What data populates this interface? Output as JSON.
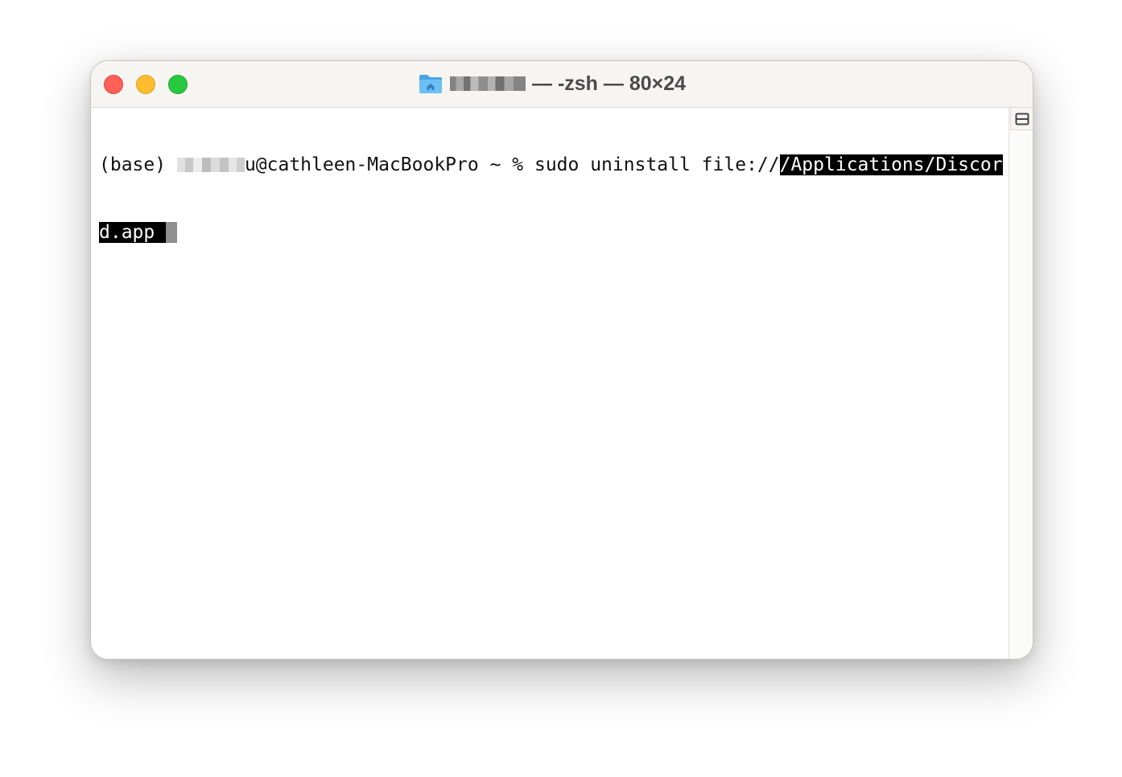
{
  "window": {
    "title_text": "— -zsh — 80×24",
    "folder_icon": "home-folder-icon",
    "controls": {
      "close": "close-icon",
      "minimize": "minimize-icon",
      "maximize": "maximize-icon"
    }
  },
  "terminal": {
    "prompt_prefix": "(base) ",
    "prompt_host": "u@cathleen-MacBookPro ~ % ",
    "command": "sudo uninstall file://",
    "selected_line1": "/Applications/Discor",
    "selected_line2": "d.app "
  },
  "colors": {
    "close": "#fe5f57",
    "minimize": "#febc2e",
    "maximize": "#28c840",
    "folder": "#5bb4f1",
    "selection_bg": "#000000",
    "selection_fg": "#ffffff"
  }
}
